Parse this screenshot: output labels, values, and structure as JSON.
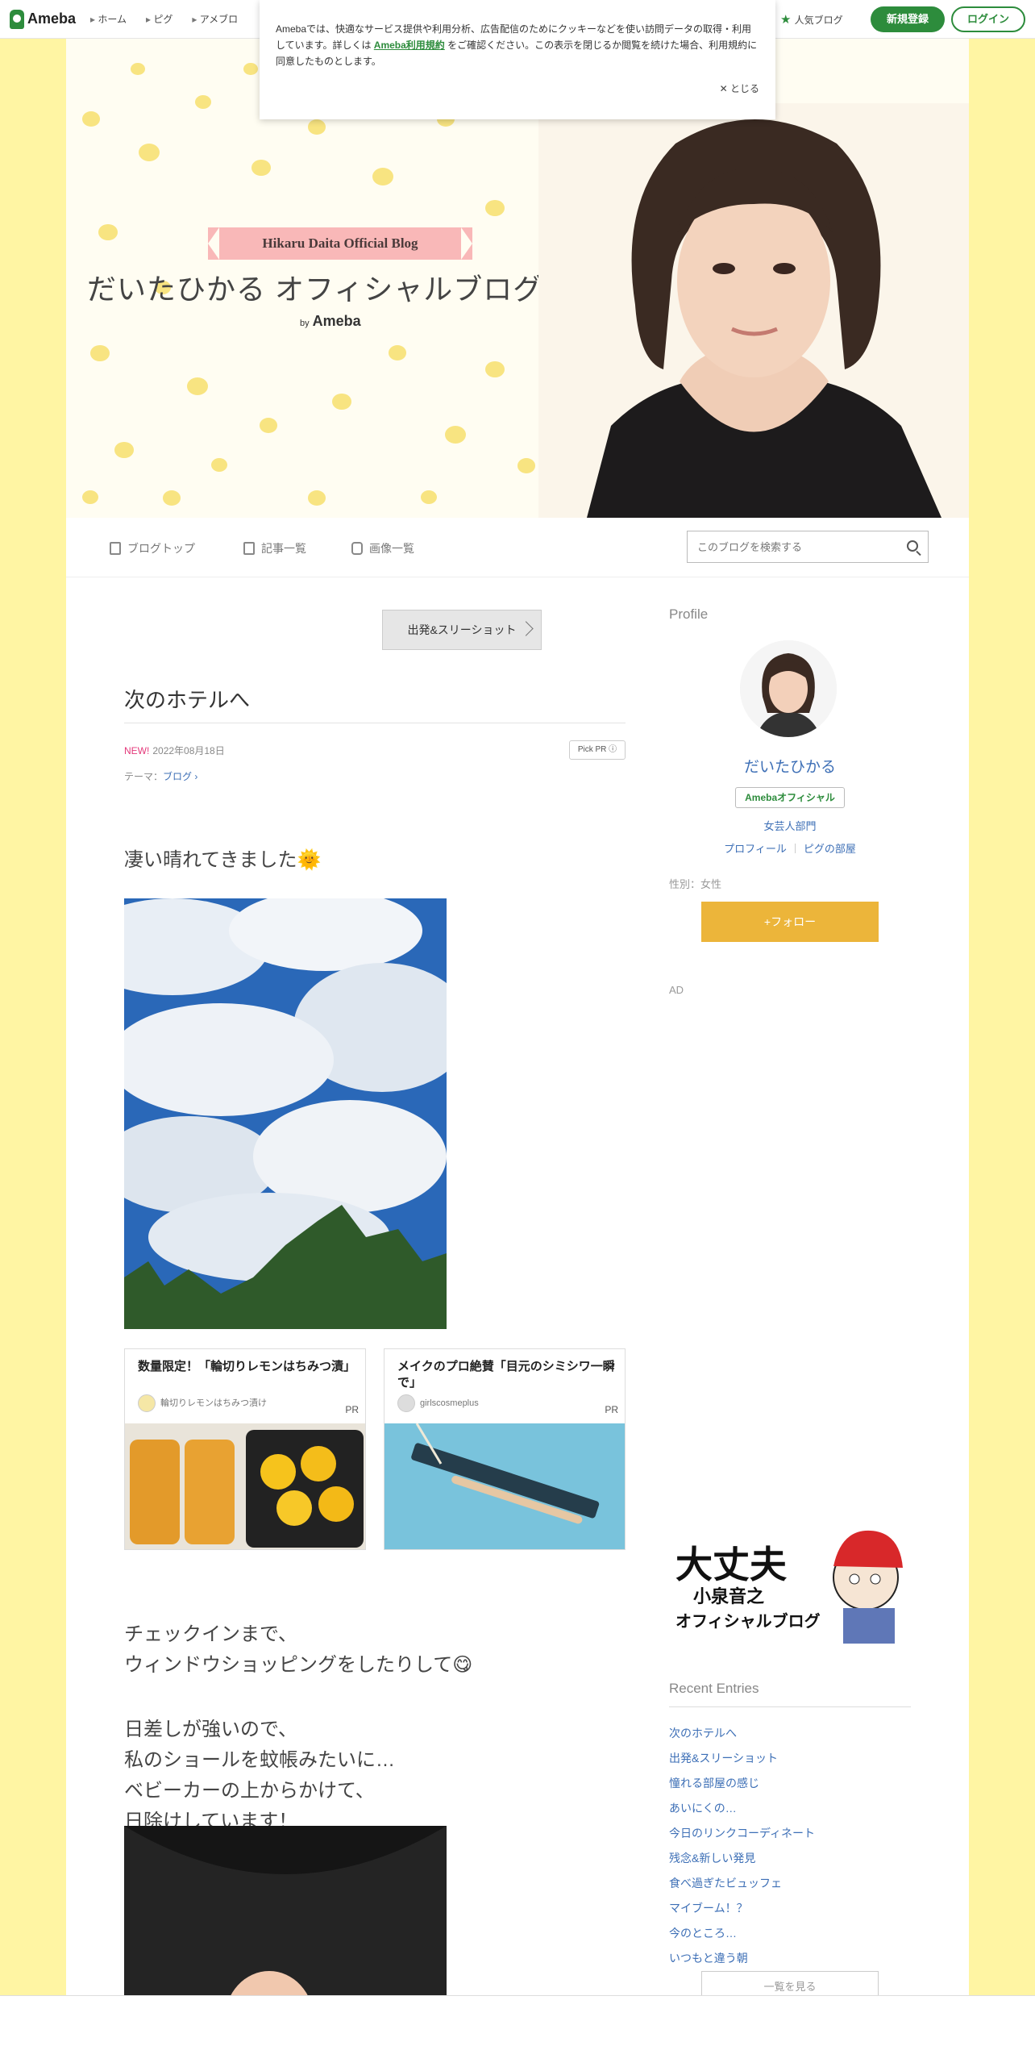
{
  "topnav": {
    "logo": "Ameba",
    "links": [
      "ホーム",
      "ピグ",
      "アメブロ"
    ],
    "popular_blog": "人気ブログ",
    "register": "新規登録",
    "login": "ログイン"
  },
  "cookie": {
    "text_before": "Amebaでは、快適なサービス提供や利用分析、広告配信のためにクッキーなどを使い訪問データの取得・利用しています。詳しくは",
    "link": "Ameba利用規約",
    "text_after": "をご確認ください。この表示を閉じるか閲覧を続けた場合、利用規約に同意したものとします。",
    "close": "とじる"
  },
  "header": {
    "ribbon": "Hikaru Daita Official Blog",
    "title": "だいたひかる オフィシャルブログ",
    "by": "by",
    "ameba": "Ameba"
  },
  "subnav": {
    "top": "ブログトップ",
    "entries": "記事一覧",
    "images": "画像一覧",
    "search_placeholder": "このブログを検索する"
  },
  "article": {
    "prev_button": "出発&スリーショット",
    "title": "次のホテルへ",
    "new_label": "NEW!",
    "date": "2022年08月18日",
    "pick_pr": "Pick PR ⓘ",
    "theme_label": "テーマ：",
    "theme_link": "ブログ ›",
    "line1": "凄い晴れてきました🌞",
    "para2": [
      "チェックインまで、",
      "ウィンドウショッピングをしたりして😋"
    ],
    "para3": [
      "日差しが強いので、",
      "私のショールを蚊帳みたいに…",
      "ベビーカーの上からかけて、",
      "日除けしています！"
    ]
  },
  "pr_cards": [
    {
      "title": "数量限定！「輪切りレモンはちみつ漬」",
      "brand": "輪切りレモンはちみつ漬け",
      "tag": "PR"
    },
    {
      "title": "メイクのプロ絶賛「目元のシミシワ一瞬で」",
      "brand": "girlscosmeplus",
      "tag": "PR"
    }
  ],
  "sidebar": {
    "profile_heading": "Profile",
    "name": "だいたひかる",
    "badge": "Amebaオフィシャル",
    "category": "女芸人部門",
    "profile_link": "プロフィール",
    "pig_link": "ピグの部屋",
    "gender": "性別：女性",
    "follow": "+フォロー",
    "ad": "AD",
    "banner_line1": "大丈夫",
    "banner_line2": "小泉音之",
    "banner_line3": "オフィシャルブログ",
    "recent_heading": "Recent Entries",
    "recent": [
      "次のホテルへ",
      "出発&スリーショット",
      "憧れる部屋の感じ",
      "あいにくの…",
      "今日のリンクコーディネート",
      "残念&新しい発見",
      "食べ過ぎたビュッフェ",
      "マイブーム！？",
      "今のところ…",
      "いつもと違う朝"
    ],
    "more": "一覧を見る"
  },
  "colors": {
    "ameba_green": "#2d8c3c",
    "link_blue": "#3d6fb6",
    "follow_yellow": "#ecb53a",
    "page_bg": "#fff5a3"
  }
}
